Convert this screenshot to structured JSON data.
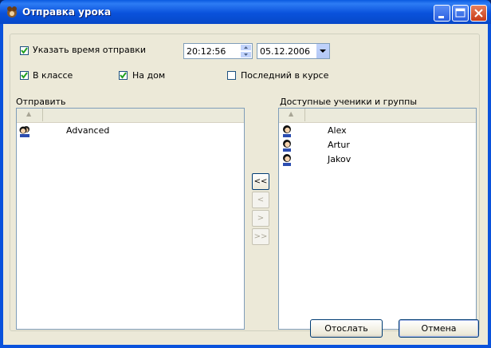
{
  "window": {
    "title": "Отправка урока"
  },
  "options": {
    "specify_time_label": "Указать время отправки",
    "specify_time_checked": true,
    "time_value": "20:12:56",
    "date_value": "05.12.2006",
    "in_class_label": "В классе",
    "in_class_checked": true,
    "home_label": "На дом",
    "home_checked": true,
    "last_in_course_label": "Последний в курсе",
    "last_in_course_checked": false
  },
  "send_list": {
    "label": "Отправить",
    "sort_indicator": "▲",
    "items": [
      {
        "name": "Advanced",
        "icon": "group-icon"
      }
    ]
  },
  "available_list": {
    "label": "Доступные ученики и группы",
    "sort_indicator": "▲",
    "items": [
      {
        "name": "Alex",
        "icon": "student-icon"
      },
      {
        "name": "Artur",
        "icon": "student-icon"
      },
      {
        "name": "Jakov",
        "icon": "student-icon"
      }
    ]
  },
  "move_buttons": {
    "all_left": "<<",
    "left": "<",
    "right": ">",
    "all_right": ">>"
  },
  "buttons": {
    "send": "Отослать",
    "cancel": "Отмена"
  }
}
